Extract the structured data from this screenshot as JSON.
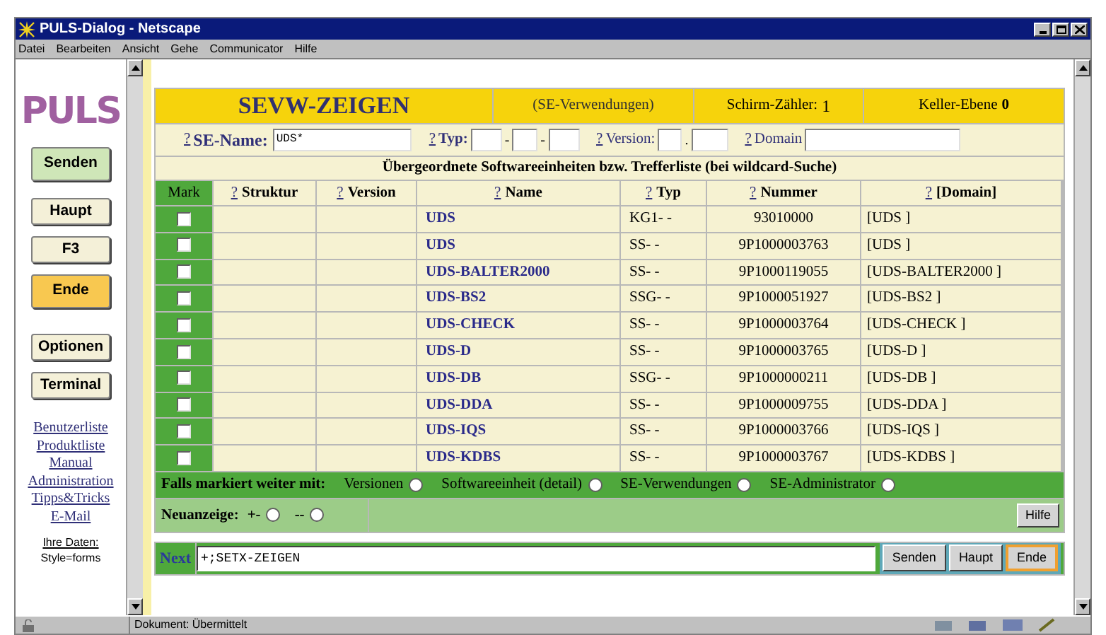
{
  "window": {
    "title": "PULS-Dialog - Netscape"
  },
  "menu": [
    "Datei",
    "Bearbeiten",
    "Ansicht",
    "Gehe",
    "Communicator",
    "Hilfe"
  ],
  "sidebar": {
    "logo": "PULS",
    "buttons": [
      {
        "label": "Senden",
        "kind": "green"
      },
      {
        "label": "Haupt",
        "kind": "plain"
      },
      {
        "label": "F3",
        "kind": "plain"
      },
      {
        "label": "Ende",
        "kind": "orange"
      },
      {
        "label": "Optionen",
        "kind": "plain"
      },
      {
        "label": "Terminal",
        "kind": "plain"
      }
    ],
    "links": [
      "Benutzerliste",
      "Produktliste",
      "Manual",
      "Administration",
      "Tipps&Tricks",
      "E-Mail"
    ],
    "footer": [
      "Ihre Daten:",
      "Style=forms"
    ]
  },
  "header": {
    "title": "SEVW-ZEIGEN",
    "subtitle": "(SE-Verwendungen)",
    "counter_label": "Schirm-Zähler:",
    "counter_value": "1",
    "level_label": "Keller-Ebene",
    "level_value": "0"
  },
  "search": [
    {
      "kind": "name",
      "help": "?",
      "label": "SE-Name:",
      "value": "UDS*"
    },
    {
      "kind": "typ",
      "help": "?",
      "label": "Typ:",
      "separator": "-"
    },
    {
      "kind": "version",
      "help": "?",
      "label": "Version:",
      "separator": "."
    },
    {
      "kind": "domain",
      "help": "?",
      "label": "Domain"
    }
  ],
  "table": {
    "caption": "Übergeordnete Softwareeinheiten bzw. Trefferliste (bei wildcard-Suche)",
    "columns": [
      {
        "label": "Mark"
      },
      {
        "help": "?",
        "label": "Struktur"
      },
      {
        "help": "?",
        "label": "Version"
      },
      {
        "help": "?",
        "label": "Name"
      },
      {
        "help": "?",
        "label": "Typ"
      },
      {
        "help": "?",
        "label": "Nummer"
      },
      {
        "help": "?",
        "label": "[Domain]"
      }
    ],
    "rows": [
      {
        "checked": false,
        "name": "UDS",
        "typ": "KG1- -",
        "nummer": "93010000",
        "domain": "[UDS ]"
      },
      {
        "checked": false,
        "name": "UDS",
        "typ": "SS- -",
        "nummer": "9P1000003763",
        "domain": "[UDS ]"
      },
      {
        "checked": false,
        "name": "UDS-BALTER2000",
        "typ": "SS- -",
        "nummer": "9P1000119055",
        "domain": "[UDS-BALTER2000 ]"
      },
      {
        "checked": false,
        "name": "UDS-BS2",
        "typ": "SSG- -",
        "nummer": "9P1000051927",
        "domain": "[UDS-BS2 ]"
      },
      {
        "checked": false,
        "name": "UDS-CHECK",
        "typ": "SS- -",
        "nummer": "9P1000003764",
        "domain": "[UDS-CHECK ]"
      },
      {
        "checked": false,
        "name": "UDS-D",
        "typ": "SS- -",
        "nummer": "9P1000003765",
        "domain": "[UDS-D ]"
      },
      {
        "checked": false,
        "name": "UDS-DB",
        "typ": "SSG- -",
        "nummer": "9P1000000211",
        "domain": "[UDS-DB ]"
      },
      {
        "checked": false,
        "name": "UDS-DDA",
        "typ": "SS- -",
        "nummer": "9P1000009755",
        "domain": "[UDS-DDA ]"
      },
      {
        "checked": false,
        "name": "UDS-IQS",
        "typ": "SS- -",
        "nummer": "9P1000003766",
        "domain": "[UDS-IQS ]"
      },
      {
        "checked": false,
        "name": "UDS-KDBS",
        "typ": "SS- -",
        "nummer": "9P1000003767",
        "domain": "[UDS-KDBS ]"
      }
    ]
  },
  "continue": {
    "label": "Falls markiert weiter mit:",
    "options": [
      {
        "label": "Versionen",
        "selected": false
      },
      {
        "label": "Softwareeinheit (detail)",
        "selected": false
      },
      {
        "label": "SE-Verwendungen",
        "selected": false
      },
      {
        "label": "SE-Administrator",
        "selected": false
      }
    ]
  },
  "redisplay": {
    "label": "Neuanzeige:",
    "options": [
      {
        "label": "+-",
        "selected": false
      },
      {
        "label": "--",
        "selected": false
      }
    ],
    "help_button": "Hilfe"
  },
  "next": {
    "label": "Next",
    "value": "+;SETX-ZEIGEN",
    "buttons": [
      {
        "label": "Senden",
        "kind": "plain"
      },
      {
        "label": "Haupt",
        "kind": "plain"
      },
      {
        "label": "Ende",
        "kind": "orange"
      }
    ]
  },
  "status_bar": "Dokument: Übermittelt"
}
